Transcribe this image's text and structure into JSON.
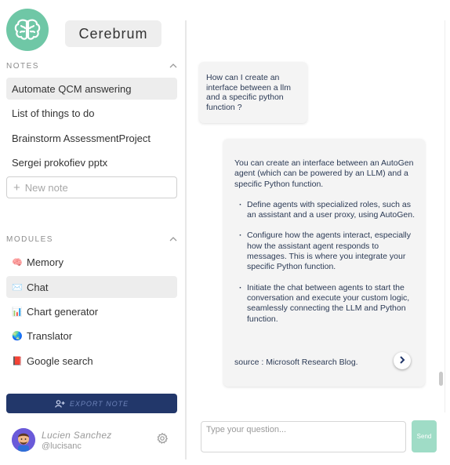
{
  "app": {
    "title": "Cerebrum",
    "logo_icon": "brain-icon",
    "accent": "#6fc7a6"
  },
  "notes": {
    "header": "NOTES",
    "items": [
      {
        "label": "Automate QCM answering",
        "active": true
      },
      {
        "label": "List of things to do"
      },
      {
        "label": "Brainstorm AssessmentProject"
      },
      {
        "label": "Sergei prokofiev pptx"
      }
    ],
    "new_note_placeholder": "New note"
  },
  "modules": {
    "header": "MODULES",
    "items": [
      {
        "icon": "brain-emoji-icon",
        "glyph": "🧠",
        "label": "Memory"
      },
      {
        "icon": "envelope-emoji-icon",
        "glyph": "✉️",
        "label": "Chat",
        "active": true
      },
      {
        "icon": "bar-chart-emoji-icon",
        "glyph": "📊",
        "label": "Chart generator"
      },
      {
        "icon": "globe-emoji-icon",
        "glyph": "🌏",
        "label": "Translator"
      },
      {
        "icon": "book-emoji-icon",
        "glyph": "📕",
        "label": "Google search"
      }
    ]
  },
  "export": {
    "label": "EXPORT NOTE",
    "color": "#22376a"
  },
  "user": {
    "name": "Lucien Sanchez",
    "handle": "@lucisanc"
  },
  "chat": {
    "user_message": "How can I create an interface between a llm and a specific python function ?",
    "bot_intro": "You can create an interface between an AutoGen agent (which can be powered by an LLM) and a specific Python function.",
    "bot_points": [
      "Define agents with specialized roles, such as an assistant and a user proxy, using AutoGen.",
      "Configure how the agents interact, especially how the assistant agent responds to messages. This is where you integrate your specific Python function.",
      "Initiate the chat between agents to start the conversation and execute your custom logic, seamlessly connecting the LLM and Python function."
    ],
    "source_label": "source :",
    "source_value": "Microsoft Research Blog.",
    "input_placeholder": "Type your question...",
    "send_label": "Send",
    "send_color": "#9fdcc6"
  }
}
